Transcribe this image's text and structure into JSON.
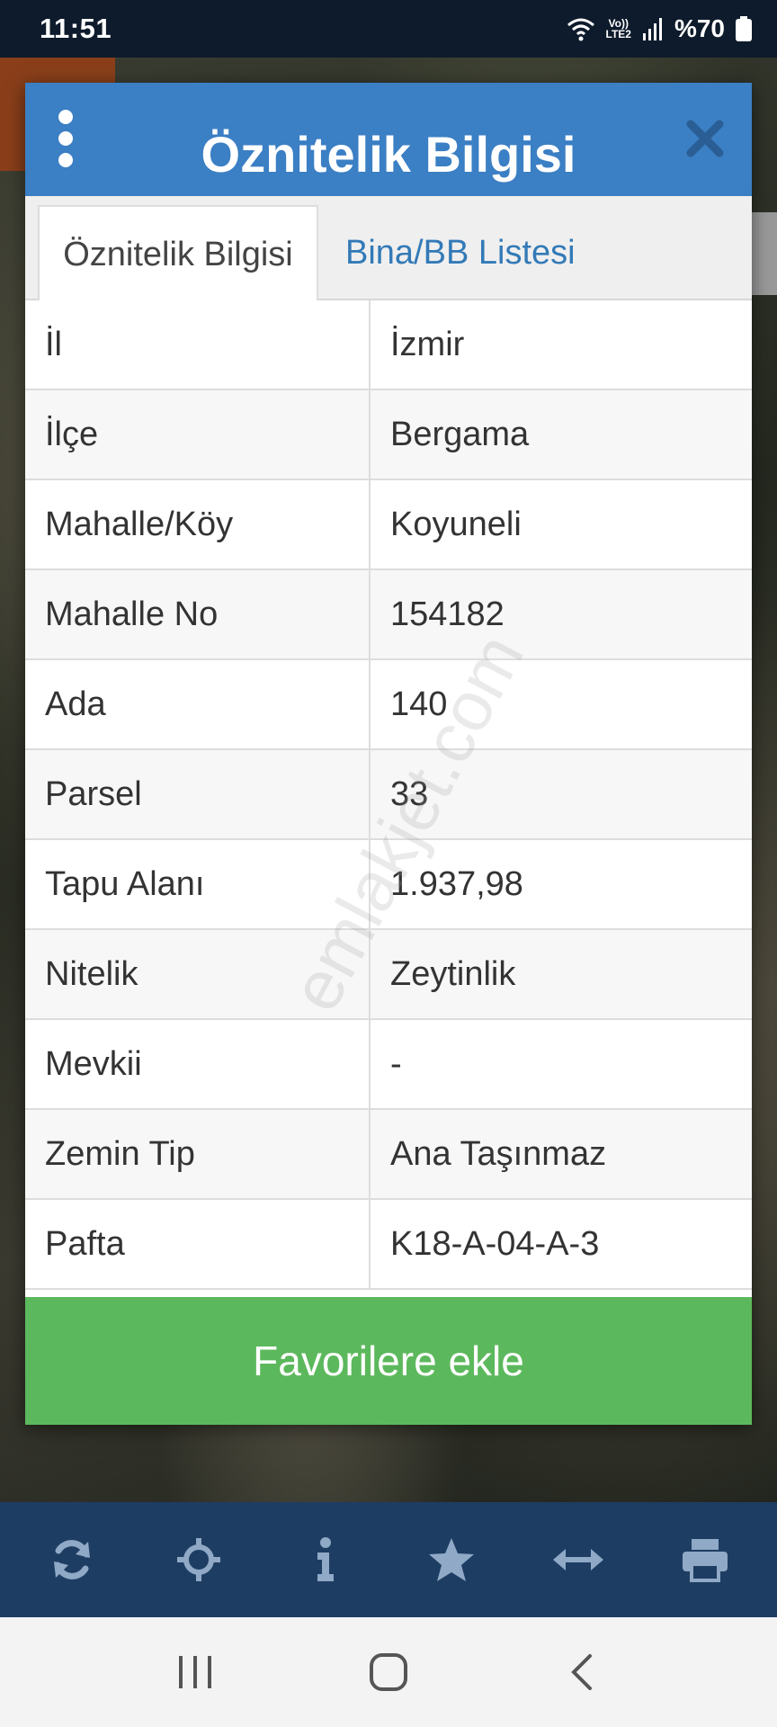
{
  "status_bar": {
    "time": "11:51",
    "network_top": "Vo))",
    "network_bottom": "LTE2",
    "battery": "%70"
  },
  "dialog": {
    "title": "Öznitelik Bilgisi",
    "header_color": "#3b7fc4",
    "tabs": [
      {
        "label": "Öznitelik Bilgisi",
        "active": true
      },
      {
        "label": "Bina/BB Listesi",
        "active": false
      }
    ],
    "rows": [
      {
        "label": "İl",
        "value": "İzmir"
      },
      {
        "label": "İlçe",
        "value": "Bergama"
      },
      {
        "label": "Mahalle/Köy",
        "value": "Koyuneli"
      },
      {
        "label": "Mahalle No",
        "value": "154182"
      },
      {
        "label": "Ada",
        "value": "140"
      },
      {
        "label": "Parsel",
        "value": "33"
      },
      {
        "label": "Tapu Alanı",
        "value": "1.937,98"
      },
      {
        "label": "Nitelik",
        "value": "Zeytinlik"
      },
      {
        "label": "Mevkii",
        "value": "-"
      },
      {
        "label": "Zemin Tip",
        "value": "Ana Taşınmaz"
      },
      {
        "label": "Pafta",
        "value": "K18-A-04-A-3"
      }
    ],
    "favorite_label": "Favorilere ekle",
    "favorite_color": "#5cb85c",
    "watermark": "emlakjet.com"
  },
  "toolbar": {
    "items": [
      "refresh-icon",
      "crosshair-icon",
      "info-icon",
      "star-icon",
      "arrows-horizontal-icon",
      "print-icon"
    ]
  },
  "navbar": {
    "items": [
      "recent-apps-icon",
      "home-icon",
      "back-icon"
    ]
  }
}
